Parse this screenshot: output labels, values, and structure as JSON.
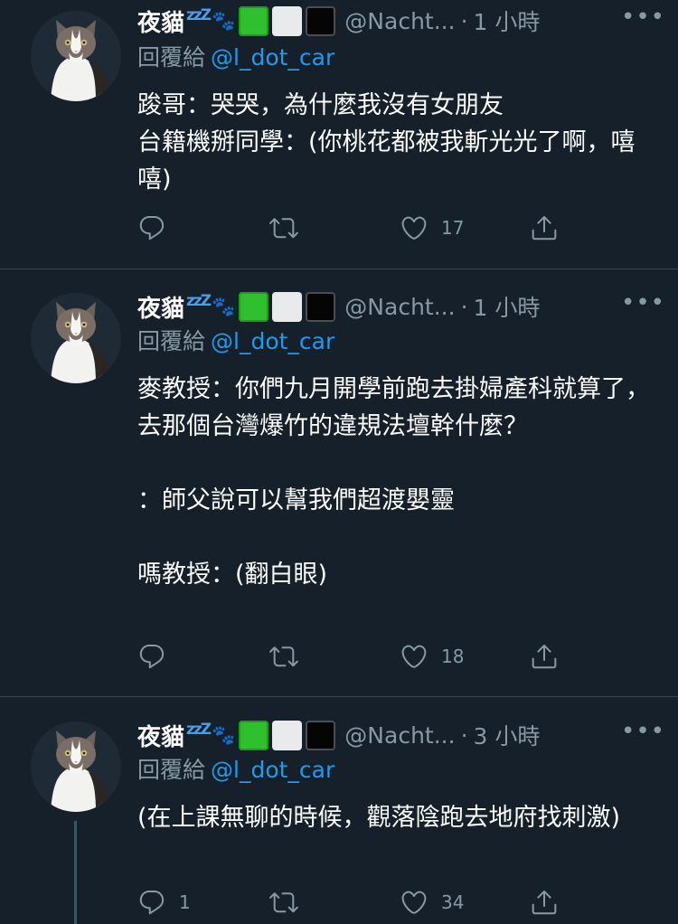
{
  "colors": {
    "background": "#15202b",
    "divider": "#38444d",
    "muted": "#8899a6",
    "link": "#1d9bf0"
  },
  "tweets": [
    {
      "name": "夜貓",
      "sleep": "zzZ",
      "handle": "@Nacht...",
      "dot": "·",
      "time": "1 小時",
      "more": "•••",
      "reply_label": "回覆給",
      "reply_to": "@l_dot_car",
      "text": "踆哥：哭哭，為什麼我沒有女朋友\n台籍機掰同學：(你桃花都被我斬光光了啊，嘻嘻)",
      "replies": "",
      "retweets": "",
      "likes": "17"
    },
    {
      "name": "夜貓",
      "sleep": "zzZ",
      "handle": "@Nacht...",
      "dot": "·",
      "time": "1 小時",
      "more": "•••",
      "reply_label": "回覆給",
      "reply_to": "@l_dot_car",
      "text": "麥教授：你們九月開學前跑去掛婦產科就算了，\n去那個台灣爆竹的違規法壇幹什麼？\n\n：師父說可以幫我們超渡嬰靈\n\n嗎教授：(翻白眼)",
      "replies": "",
      "retweets": "",
      "likes": "18"
    },
    {
      "name": "夜貓",
      "sleep": "zzZ",
      "handle": "@Nacht...",
      "dot": "·",
      "time": "3 小時",
      "more": "•••",
      "reply_label": "回覆給",
      "reply_to": "@l_dot_car",
      "text": "(在上課無聊的時候，觀落陰跑去地府找刺激)",
      "replies": "1",
      "retweets": "",
      "likes": "34"
    }
  ]
}
